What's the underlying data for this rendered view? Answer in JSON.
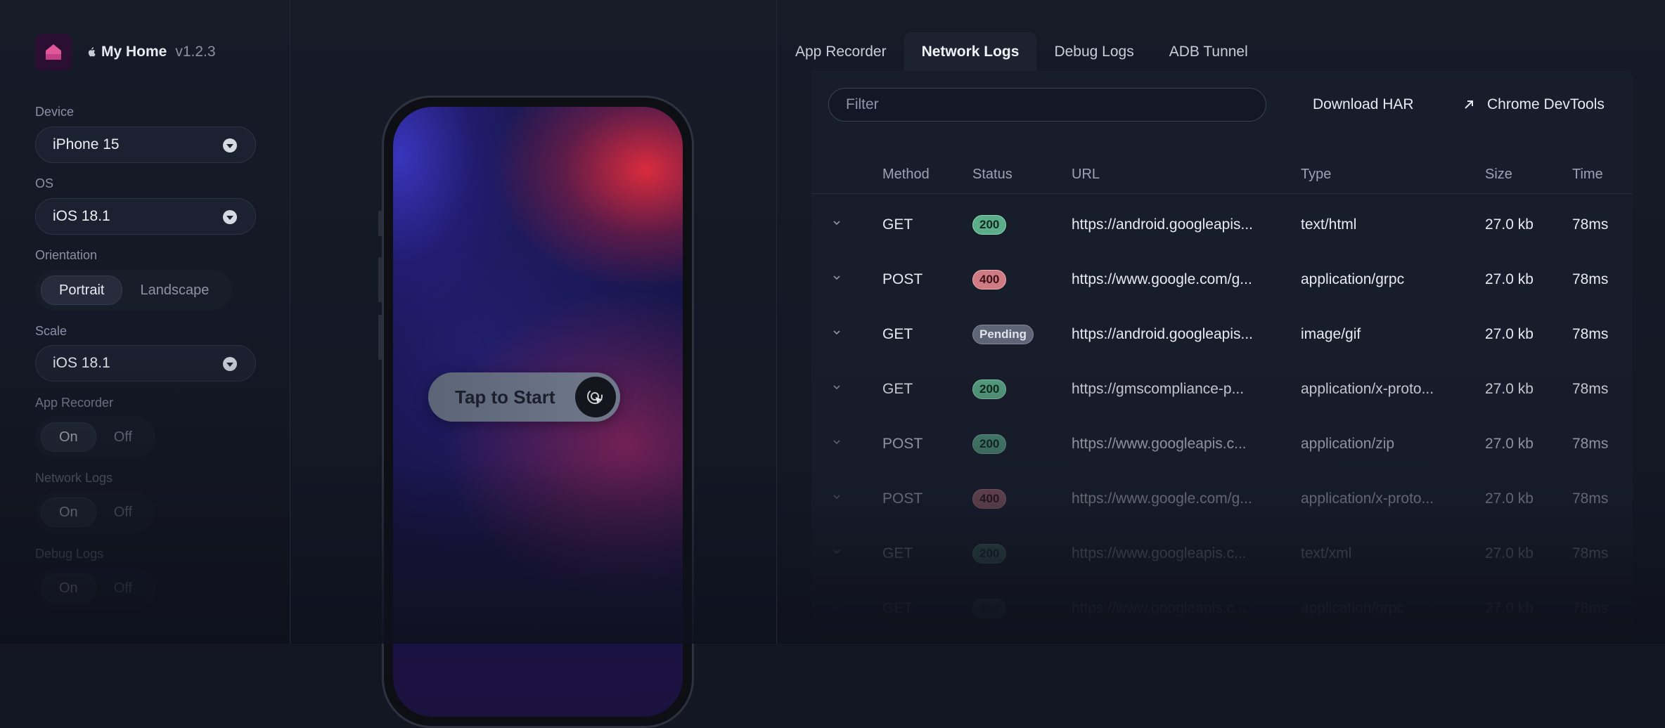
{
  "app": {
    "name": "My Home",
    "version": "v1.2.3"
  },
  "sidebar": {
    "device": {
      "label": "Device",
      "value": "iPhone 15"
    },
    "os": {
      "label": "OS",
      "value": "iOS 18.1"
    },
    "orientation": {
      "label": "Orientation",
      "options": [
        "Portrait",
        "Landscape"
      ],
      "selected": "Portrait"
    },
    "scale": {
      "label": "Scale",
      "value": "iOS 18.1"
    },
    "app_recorder": {
      "label": "App Recorder",
      "on": "On",
      "off": "Off"
    },
    "network_logs": {
      "label": "Network Logs",
      "on": "On",
      "off": "Off"
    },
    "debug_logs": {
      "label": "Debug Logs",
      "on": "On",
      "off": "Off"
    }
  },
  "phone": {
    "tap_to_start": "Tap to Start"
  },
  "tabs": [
    "App Recorder",
    "Network Logs",
    "Debug Logs",
    "ADB Tunnel"
  ],
  "active_tab": "Network Logs",
  "network": {
    "filter_placeholder": "Filter",
    "download_har": "Download HAR",
    "chrome_devtools": "Chrome DevTools",
    "columns": [
      "Method",
      "Status",
      "URL",
      "Type",
      "Size",
      "Time"
    ],
    "rows": [
      {
        "method": "GET",
        "status": "200",
        "status_kind": "ok",
        "url": "https://android.googleapis...",
        "type": "text/html",
        "size": "27.0 kb",
        "time": "78ms"
      },
      {
        "method": "POST",
        "status": "400",
        "status_kind": "error",
        "url": "https://www.google.com/g...",
        "type": "application/grpc",
        "size": "27.0 kb",
        "time": "78ms"
      },
      {
        "method": "GET",
        "status": "Pending",
        "status_kind": "pending",
        "url": "https://android.googleapis...",
        "type": "image/gif",
        "size": "27.0 kb",
        "time": "78ms"
      },
      {
        "method": "GET",
        "status": "200",
        "status_kind": "ok",
        "url": "https://gmscompliance-p...",
        "type": "application/x-proto...",
        "size": "27.0 kb",
        "time": "78ms"
      },
      {
        "method": "POST",
        "status": "200",
        "status_kind": "ok",
        "url": "https://www.googleapis.c...",
        "type": "application/zip",
        "size": "27.0 kb",
        "time": "78ms"
      },
      {
        "method": "POST",
        "status": "400",
        "status_kind": "error",
        "url": "https://www.google.com/g...",
        "type": "application/x-proto...",
        "size": "27.0 kb",
        "time": "78ms"
      },
      {
        "method": "GET",
        "status": "200",
        "status_kind": "ok",
        "url": "https://www.googleapis.c...",
        "type": "text/xml",
        "size": "27.0 kb",
        "time": "78ms"
      },
      {
        "method": "GET",
        "status": "200",
        "status_kind": "ok",
        "url": "https://www.googleapis.c...",
        "type": "application/grpc",
        "size": "27.0 kb",
        "time": "78ms"
      }
    ]
  },
  "colors": {
    "background": "#131722",
    "panel": "#181d2b",
    "status_ok": "#5cae8a",
    "status_error": "#cf7b83",
    "status_pending": "#5e6577",
    "brand_logo": "#e0579b"
  }
}
